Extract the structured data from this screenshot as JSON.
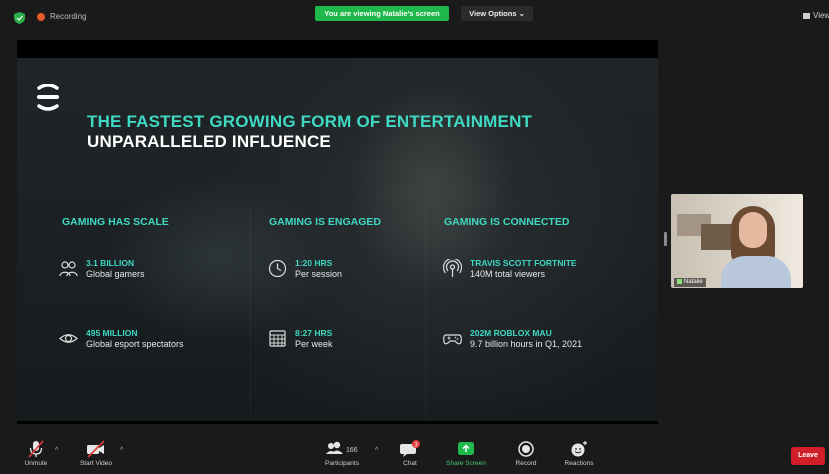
{
  "topbar": {
    "recording_label": "Recording",
    "viewing_banner": "You are viewing Natalie's screen",
    "view_options": "View Options ⌄",
    "view_toggle": "View",
    "colors": {
      "recording": "#e55a2a",
      "banner": "#1fb84a",
      "secure": "#2ab04a"
    }
  },
  "slide": {
    "headline": "THE FASTEST GROWING FORM OF ENTERTAINMENT",
    "subheadline": "UNPARALLELED INFLUENCE",
    "accent_color": "#3fd9c3",
    "columns": [
      {
        "title": "GAMING HAS SCALE",
        "stats": [
          {
            "icon": "people-icon",
            "value": "3.1 BILLION",
            "label": "Global gamers"
          },
          {
            "icon": "eye-icon",
            "value": "495 MILLION",
            "label": "Global esport spectators"
          }
        ]
      },
      {
        "title": "GAMING IS ENGAGED",
        "stats": [
          {
            "icon": "clock-icon",
            "value": "1:20 HRS",
            "label": "Per session"
          },
          {
            "icon": "calendar-icon",
            "value": "8:27 HRS",
            "label": "Per week"
          }
        ]
      },
      {
        "title": "GAMING IS CONNECTED",
        "stats": [
          {
            "icon": "broadcast-icon",
            "value": "TRAVIS SCOTT FORTNITE",
            "label": "140M total viewers"
          },
          {
            "icon": "gamepad-icon",
            "value": "202M ROBLOX MAU",
            "label": "9.7 billion hours in Q1, 2021"
          }
        ]
      }
    ]
  },
  "participant": {
    "name": "Natalie"
  },
  "toolbar": {
    "unmute": "Unmute",
    "start_video": "Start Video",
    "participants": "Participants",
    "participant_count": "166",
    "chat": "Chat",
    "chat_badge": "3",
    "share_screen": "Share Screen",
    "record": "Record",
    "reactions": "Reactions",
    "leave": "Leave",
    "caret": "^"
  }
}
